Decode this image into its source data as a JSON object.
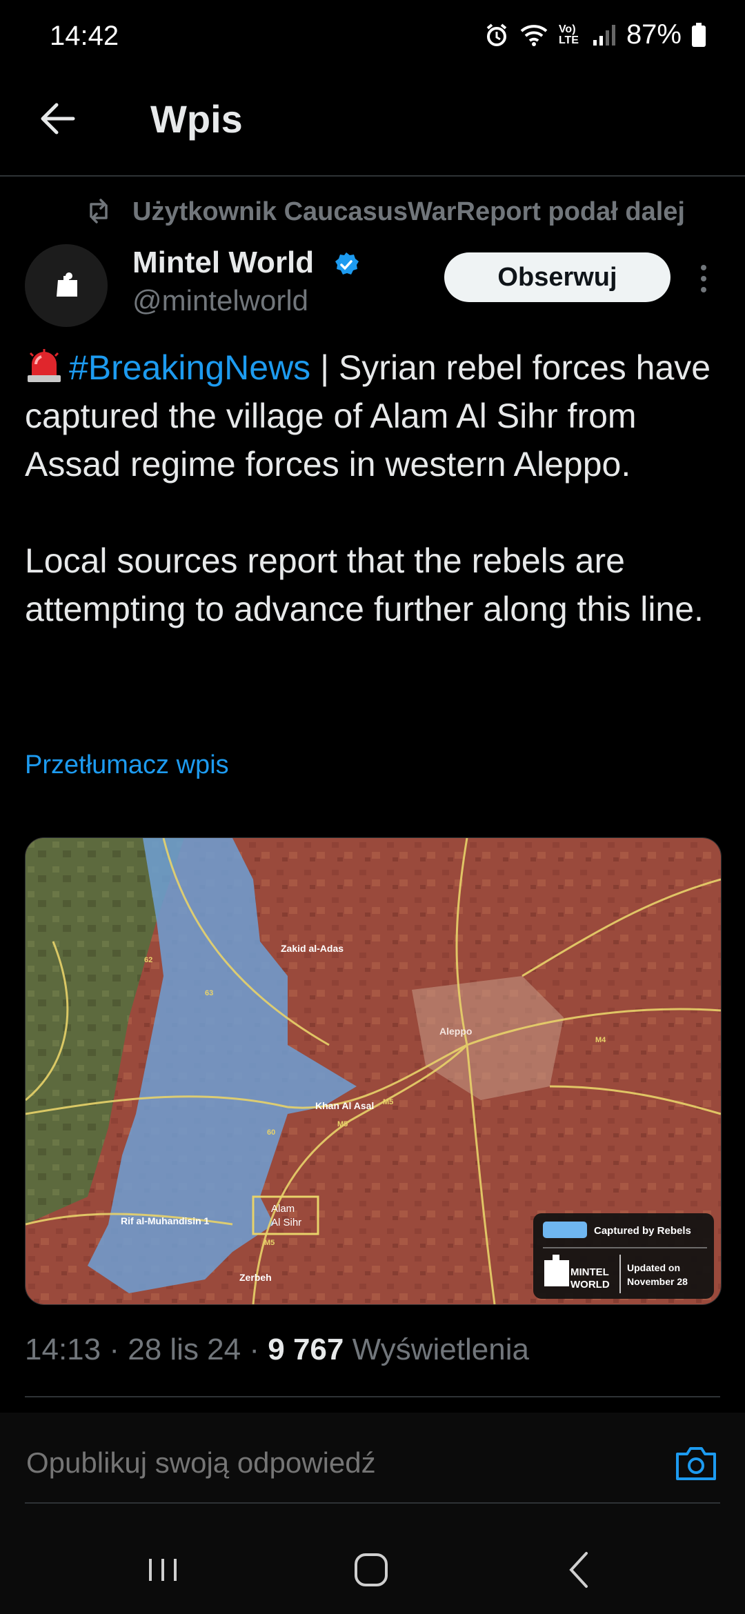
{
  "status_bar": {
    "time": "14:42",
    "signal_label": "Vo) LTE",
    "battery": "87%"
  },
  "header": {
    "title": "Wpis"
  },
  "repost": {
    "text": "Użytkownik CaucasusWarReport podał dalej"
  },
  "author": {
    "name": "Mintel World",
    "handle": "@mintelworld",
    "follow_label": "Obserwuj"
  },
  "tweet": {
    "hashtag": "#BreakingNews",
    "line1": " | Syrian rebel forces have captured the village of Alam Al Sihr from Assad regime forces in western Aleppo.",
    "line2": "Local sources report that the rebels are attempting to advance further along this line.",
    "translate": "Przetłumacz wpis"
  },
  "map": {
    "labels": {
      "zakid": "Zakid al-Adas",
      "khan": "Khan Al Asal",
      "aleppo": "Aleppo",
      "rif": "Rif al-Muhandisin 1",
      "zerbeh": "Zerbeh",
      "alam1": "Alam",
      "alam2": "Al Sihr",
      "m5a": "M5",
      "m5b": "M5",
      "m5c": "M5",
      "m4": "M4",
      "r60": "60",
      "r62": "62",
      "r63": "63"
    },
    "legend": {
      "captured": "Captured by Rebels",
      "brand1": "MINTEL",
      "brand2": "WORLD",
      "updated1": "Updated on",
      "updated2": "November 28"
    },
    "colors": {
      "rebel_blue": "#6f9fd4",
      "regime_red": "#9a4a3c",
      "terrain_green": "#5d6a3e",
      "road_yellow": "#e8d36a"
    }
  },
  "meta": {
    "time": "14:13",
    "date": "28 lis 24",
    "views_count": "9 767",
    "views_label": "Wyświetlenia"
  },
  "reply": {
    "placeholder": "Opublikuj swoją odpowiedź"
  },
  "colors": {
    "accent": "#1d9bf0",
    "background": "#000000",
    "muted": "#71767b"
  }
}
